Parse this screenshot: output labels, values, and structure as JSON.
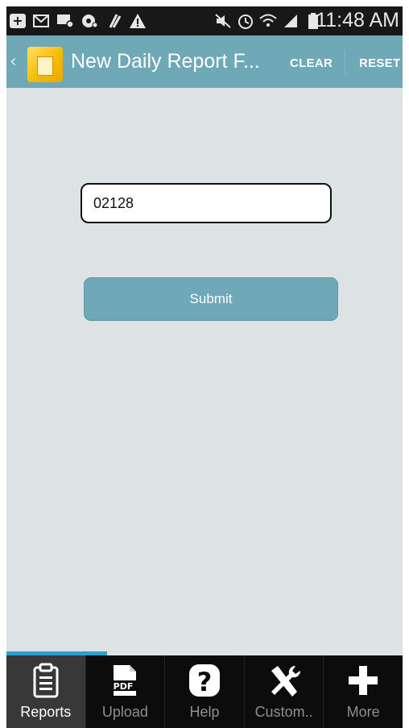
{
  "status_bar": {
    "time": "11:48 AM",
    "left_icons": [
      "add-box-icon",
      "gmail-icon",
      "message-icon",
      "at-sign-icon",
      "clip-icon",
      "warning-icon"
    ],
    "right_icons": [
      "mute-icon",
      "alarm-icon",
      "wifi-icon",
      "signal-icon",
      "battery-icon"
    ]
  },
  "app_bar": {
    "title": "New Daily Report F...",
    "clear_label": "CLEAR",
    "reset_label": "RESET"
  },
  "form": {
    "input_value": "02128",
    "submit_label": "Submit"
  },
  "tabs": [
    {
      "label": "Reports",
      "icon": "clipboard-icon",
      "active": true
    },
    {
      "label": "Upload",
      "icon": "pdf-icon",
      "active": false
    },
    {
      "label": "Help",
      "icon": "help-icon",
      "active": false
    },
    {
      "label": "Custom..",
      "icon": "tools-icon",
      "active": false
    },
    {
      "label": "More",
      "icon": "plus-icon",
      "active": false
    }
  ],
  "colors": {
    "accent": "#6fa8b6",
    "background": "#dde3e4",
    "tab_indicator": "#2f9fd0"
  }
}
